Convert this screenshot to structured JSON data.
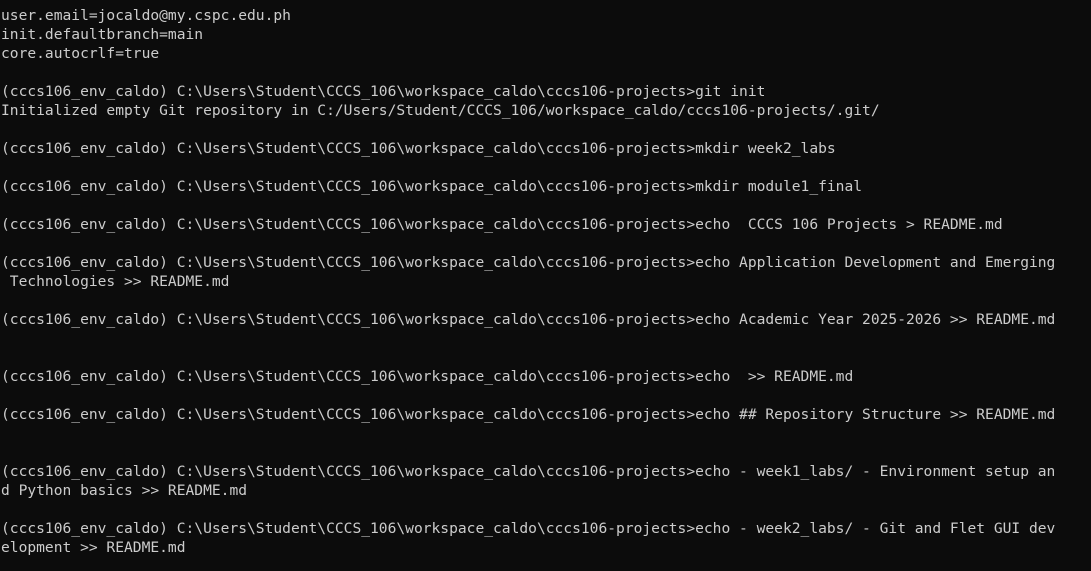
{
  "theme": {
    "background": "#0c0c0c",
    "foreground": "#cccccc"
  },
  "terminal": {
    "lines": [
      "user.email=jocaldo@my.cspc.edu.ph",
      "init.defaultbranch=main",
      "core.autocrlf=true",
      "",
      "(cccs106_env_caldo) C:\\Users\\Student\\CCCS_106\\workspace_caldo\\cccs106-projects>git init",
      "Initialized empty Git repository in C:/Users/Student/CCCS_106/workspace_caldo/cccs106-projects/.git/",
      "",
      "(cccs106_env_caldo) C:\\Users\\Student\\CCCS_106\\workspace_caldo\\cccs106-projects>mkdir week2_labs",
      "",
      "(cccs106_env_caldo) C:\\Users\\Student\\CCCS_106\\workspace_caldo\\cccs106-projects>mkdir module1_final",
      "",
      "(cccs106_env_caldo) C:\\Users\\Student\\CCCS_106\\workspace_caldo\\cccs106-projects>echo  CCCS 106 Projects > README.md",
      "",
      "(cccs106_env_caldo) C:\\Users\\Student\\CCCS_106\\workspace_caldo\\cccs106-projects>echo Application Development and Emerging",
      " Technologies >> README.md",
      "",
      "(cccs106_env_caldo) C:\\Users\\Student\\CCCS_106\\workspace_caldo\\cccs106-projects>echo Academic Year 2025-2026 >> README.md",
      "",
      "",
      "(cccs106_env_caldo) C:\\Users\\Student\\CCCS_106\\workspace_caldo\\cccs106-projects>echo  >> README.md",
      "",
      "(cccs106_env_caldo) C:\\Users\\Student\\CCCS_106\\workspace_caldo\\cccs106-projects>echo ## Repository Structure >> README.md",
      "",
      "",
      "(cccs106_env_caldo) C:\\Users\\Student\\CCCS_106\\workspace_caldo\\cccs106-projects>echo - week1_labs/ - Environment setup an",
      "d Python basics >> README.md",
      "",
      "(cccs106_env_caldo) C:\\Users\\Student\\CCCS_106\\workspace_caldo\\cccs106-projects>echo - week2_labs/ - Git and Flet GUI dev",
      "elopment >> README.md"
    ]
  }
}
